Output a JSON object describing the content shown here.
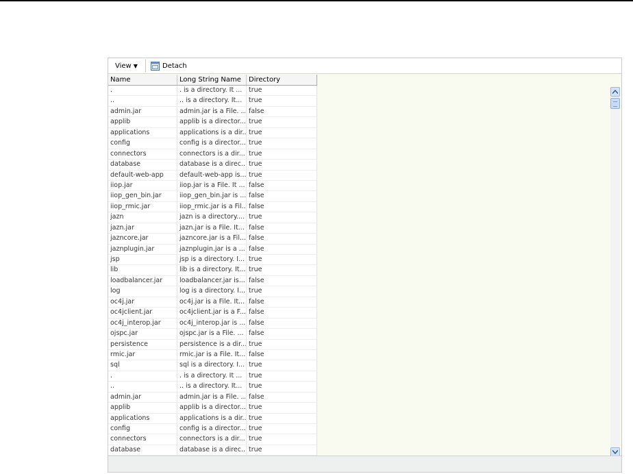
{
  "toolbar": {
    "view_label": "View",
    "view_arrow": "▼",
    "detach_label": "Detach",
    "detach_icon": "detach-icon"
  },
  "table": {
    "columns": [
      "Name",
      "Long String Name",
      "Directory"
    ],
    "rows": [
      [
        ".",
        ". is a directory. It ...",
        "true"
      ],
      [
        "..",
        ".. is a directory. It...",
        "true"
      ],
      [
        "admin.jar",
        "admin.jar is a File. ...",
        "false"
      ],
      [
        "applib",
        "applib is a director...",
        "true"
      ],
      [
        "applications",
        "applications is a dir...",
        "true"
      ],
      [
        "config",
        "config is a director...",
        "true"
      ],
      [
        "connectors",
        "connectors is a dir...",
        "true"
      ],
      [
        "database",
        "database is a direc...",
        "true"
      ],
      [
        "default-web-app",
        "default-web-app is...",
        "true"
      ],
      [
        "iiop.jar",
        "iiop.jar is a File. It ...",
        "false"
      ],
      [
        "iiop_gen_bin.jar",
        "iiop_gen_bin.jar is ...",
        "false"
      ],
      [
        "iiop_rmic.jar",
        "iiop_rmic.jar is a Fil...",
        "false"
      ],
      [
        "jazn",
        "jazn is a directory....",
        "true"
      ],
      [
        "jazn.jar",
        "jazn.jar is a File. It...",
        "false"
      ],
      [
        "jazncore.jar",
        "jazncore.jar is a Fil...",
        "false"
      ],
      [
        "jaznplugin.jar",
        "jaznplugin.jar is a ...",
        "false"
      ],
      [
        "jsp",
        "jsp is a directory. I...",
        "true"
      ],
      [
        "lib",
        "lib is a directory. It...",
        "true"
      ],
      [
        "loadbalancer.jar",
        "loadbalancer.jar is...",
        "false"
      ],
      [
        "log",
        "log is a directory. I...",
        "true"
      ],
      [
        "oc4j.jar",
        "oc4j.jar is a File. It...",
        "false"
      ],
      [
        "oc4jclient.jar",
        "oc4jclient.jar is a F...",
        "false"
      ],
      [
        "oc4j_interop.jar",
        "oc4j_interop.jar is ...",
        "false"
      ],
      [
        "ojspc.jar",
        "ojspc.jar is a File. ...",
        "false"
      ],
      [
        "persistence",
        "persistence is a dir...",
        "true"
      ],
      [
        "rmic.jar",
        "rmic.jar is a File. It...",
        "false"
      ],
      [
        "sql",
        "sql is a directory. I...",
        "true"
      ],
      [
        ".",
        ". is a directory. It ...",
        "true"
      ],
      [
        "..",
        ".. is a directory. It...",
        "true"
      ],
      [
        "admin.jar",
        "admin.jar is a File. ...",
        "false"
      ],
      [
        "applib",
        "applib is a director...",
        "true"
      ],
      [
        "applications",
        "applications is a dir...",
        "true"
      ],
      [
        "config",
        "config is a director...",
        "true"
      ],
      [
        "connectors",
        "connectors is a dir...",
        "true"
      ],
      [
        "database",
        "database is a direc...",
        "true"
      ]
    ]
  },
  "scrollbar": {
    "up_icon": "scroll-up-arrow-icon",
    "down_icon": "scroll-down-arrow-icon"
  },
  "colors": {
    "panel_background": "#fafbf0",
    "scroll_button": "#d2e3f8"
  }
}
